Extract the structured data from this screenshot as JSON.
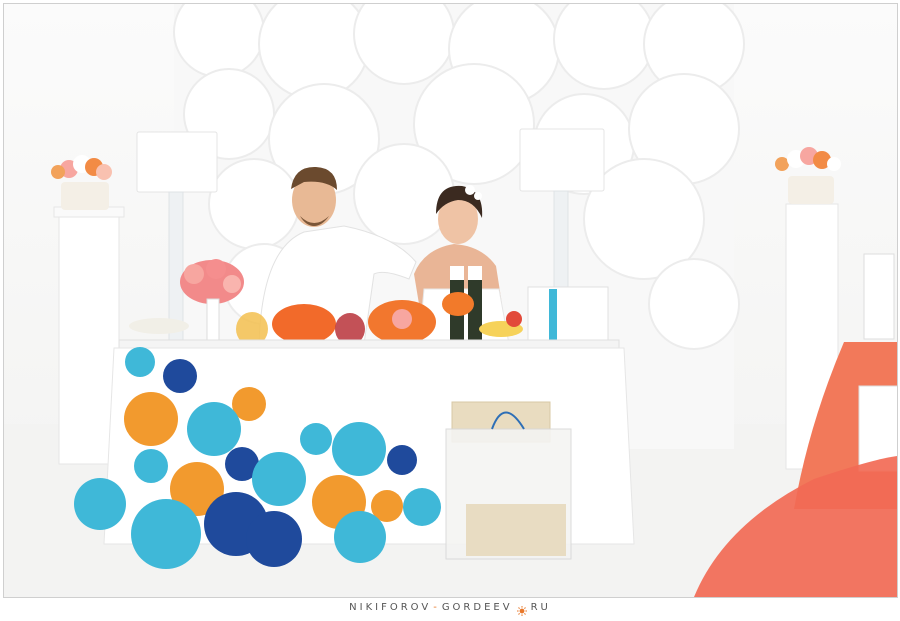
{
  "photo": {
    "subject": "",
    "palette": {
      "background": "#f7f7f6",
      "paper_flowers": "#ffffff",
      "turquoise": "#3fb8d8",
      "orange": "#f29a2e",
      "navy": "#1f4a9c",
      "coral_tablecloth": "#f2795a",
      "tablecloth": "#ffffff"
    }
  },
  "watermark": {
    "part1": "NIKIFOROV",
    "dash": "-",
    "part2": "GORDEEV",
    "part3": "RU",
    "icon": "sun-icon"
  }
}
